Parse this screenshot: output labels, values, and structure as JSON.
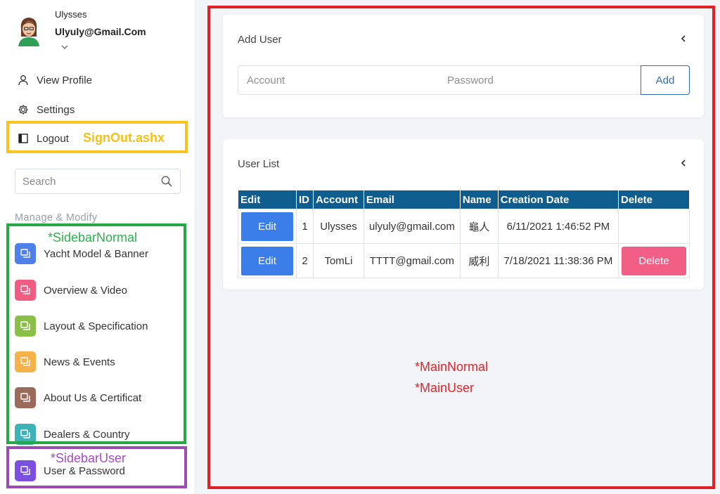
{
  "profile": {
    "name": "Ulysses",
    "email": "Ulyuly@Gmail.Com"
  },
  "menu": {
    "view_profile": "View Profile",
    "settings": "Settings",
    "logout": "Logout"
  },
  "search": {
    "placeholder": "Search"
  },
  "sidebar": {
    "section_title": "Manage & Modify",
    "items": [
      {
        "label": "Yacht Model & Banner",
        "icon": "window-icon",
        "color": "#4f7fe8"
      },
      {
        "label": "Overview & Video",
        "icon": "window-icon",
        "color": "#ef5d82"
      },
      {
        "label": "Layout & Specification",
        "icon": "window-icon",
        "color": "#8cbf4a"
      },
      {
        "label": "News & Events",
        "icon": "window-icon",
        "color": "#f5b24b"
      },
      {
        "label": "About Us & Certificat",
        "icon": "window-icon",
        "color": "#9a6a5b"
      },
      {
        "label": "Dealers & Country",
        "icon": "window-icon",
        "color": "#3db3b8"
      },
      {
        "label": "User & Password",
        "icon": "window-icon",
        "color": "#7b4fe0"
      }
    ]
  },
  "annotations": {
    "signout": "SignOut.ashx",
    "sidebar_normal": "*SidebarNormal",
    "sidebar_user": "*SidebarUser",
    "main_normal": "*MainNormal",
    "main_user": "*MainUser"
  },
  "add_user": {
    "title": "Add User",
    "account_placeholder": "Account",
    "password_placeholder": "Password",
    "add_label": "Add"
  },
  "user_list": {
    "title": "User List",
    "columns": [
      "Edit",
      "ID",
      "Account",
      "Email",
      "Name",
      "Creation Date",
      "Delete"
    ],
    "rows": [
      {
        "edit": "Edit",
        "id": "1",
        "account": "Ulysses",
        "email": "ulyuly@gmail.com",
        "name": "龜人",
        "created": "6/11/2021 1:46:52 PM",
        "delete": ""
      },
      {
        "edit": "Edit",
        "id": "2",
        "account": "TomLi",
        "email": "TTTT@gmail.com",
        "name": "威利",
        "created": "7/18/2021 11:38:36 PM",
        "delete": "Delete"
      }
    ]
  },
  "colors": {
    "table_header": "#0f5d8f",
    "edit_button": "#3b7de9",
    "delete_button": "#f25f86",
    "add_button": "#2c6fb3"
  }
}
